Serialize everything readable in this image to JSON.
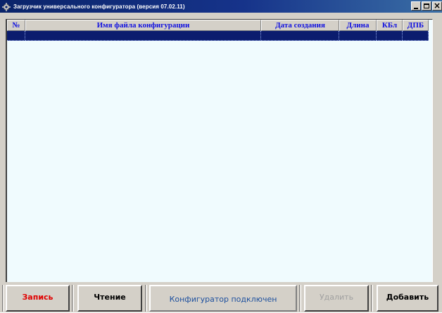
{
  "window": {
    "title": "Загрузчик универсального конфигуратора (версия 07.02.11)",
    "icon": "gear-icon",
    "controls": [
      "minimize-icon",
      "maximize-icon",
      "close-icon"
    ],
    "titlebar_color": "#0a246a"
  },
  "grid": {
    "columns": [
      {
        "label": "№"
      },
      {
        "label": "Имя файла конфигурации"
      },
      {
        "label": "Дата создания"
      },
      {
        "label": "Длина"
      },
      {
        "label": "КБл"
      },
      {
        "label": "ДПБ"
      }
    ],
    "rows": [
      [
        "",
        "",
        "",
        "",
        "",
        ""
      ]
    ],
    "header_text_color": "#1010e0",
    "selected_row_color": "#0b1c6e",
    "background_color": "#f0fbfe"
  },
  "footer": {
    "write_label": "Запись",
    "read_label": "Чтение",
    "status_text": "Конфигуратор подключен",
    "delete_label": "Удалить",
    "add_label": "Добавить",
    "write_color": "#e00000",
    "status_color": "#1c4f9e"
  }
}
